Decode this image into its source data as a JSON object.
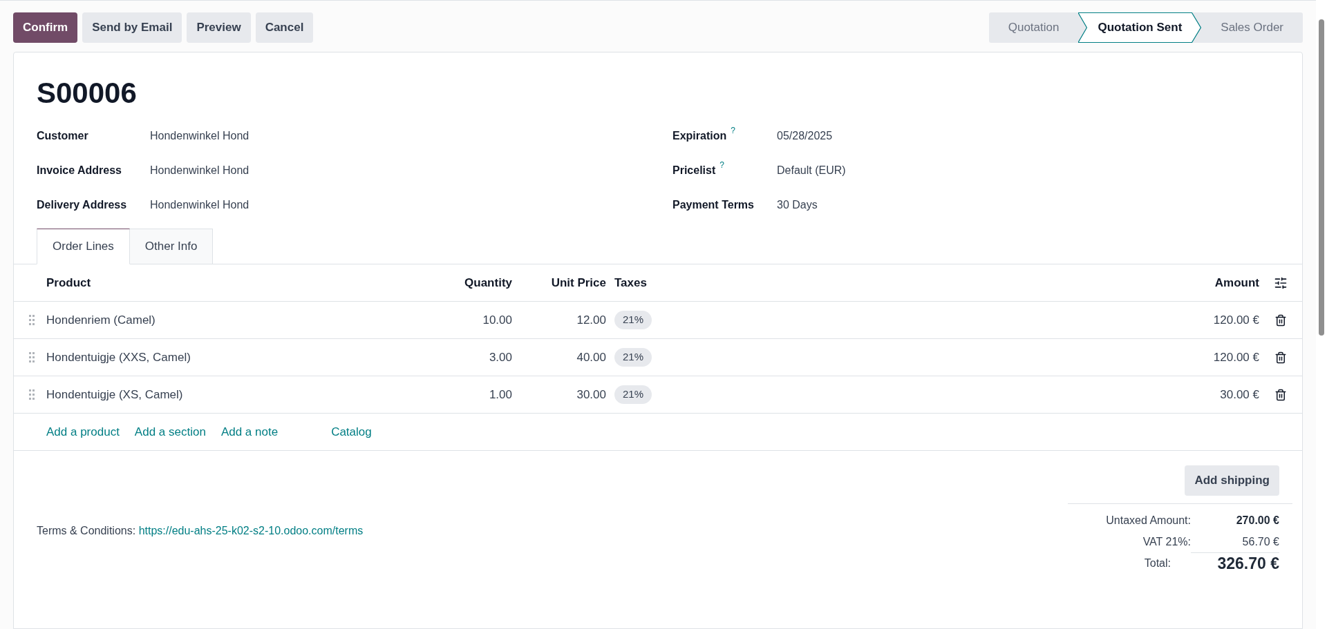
{
  "actions": [
    {
      "label": "Confirm",
      "primary": true
    },
    {
      "label": "Send by Email",
      "primary": false
    },
    {
      "label": "Preview",
      "primary": false
    },
    {
      "label": "Cancel",
      "primary": false
    }
  ],
  "status_steps": [
    {
      "label": "Quotation",
      "selected": false
    },
    {
      "label": "Quotation Sent",
      "selected": true
    },
    {
      "label": "Sales Order",
      "selected": false
    }
  ],
  "title": "S00006",
  "left_fields": [
    {
      "label": "Customer",
      "value": "Hondenwinkel Hond"
    },
    {
      "label": "Invoice Address",
      "value": "Hondenwinkel Hond"
    },
    {
      "label": "Delivery Address",
      "value": "Hondenwinkel Hond"
    }
  ],
  "right_fields": [
    {
      "label": "Expiration",
      "value": "05/28/2025",
      "help": "?"
    },
    {
      "label": "Pricelist",
      "value": "Default (EUR)",
      "help": "?"
    },
    {
      "label": "Payment Terms",
      "value": "30 Days"
    }
  ],
  "tabs": [
    {
      "label": "Order Lines",
      "selected": true
    },
    {
      "label": "Other Info",
      "selected": false
    }
  ],
  "table": {
    "columns": [
      "Product",
      "Quantity",
      "Unit Price",
      "Taxes",
      "Amount"
    ],
    "rows": [
      {
        "product": "Hondenriem (Camel)",
        "quantity": "10.00",
        "unit_price": "12.00",
        "tax": "21%",
        "amount": "120.00 €"
      },
      {
        "product": "Hondentuigje (XXS, Camel)",
        "quantity": "3.00",
        "unit_price": "40.00",
        "tax": "21%",
        "amount": "120.00 €"
      },
      {
        "product": "Hondentuigje (XS, Camel)",
        "quantity": "1.00",
        "unit_price": "30.00",
        "tax": "21%",
        "amount": "30.00 €"
      }
    ],
    "add_links": [
      "Add a product",
      "Add a section",
      "Add a note",
      "Catalog"
    ]
  },
  "add_shipping": "Add shipping",
  "terms": {
    "label": "Terms & Conditions:",
    "link": "https://edu-ahs-25-k02-s2-10.odoo.com/terms"
  },
  "totals": [
    {
      "label": "Untaxed Amount:",
      "value": "270.00 €",
      "kind": "subtotal"
    },
    {
      "label": "VAT 21%:",
      "value": "56.70 €",
      "kind": "tax"
    },
    {
      "label": "Total:",
      "value": "326.70 €",
      "kind": "total"
    }
  ]
}
